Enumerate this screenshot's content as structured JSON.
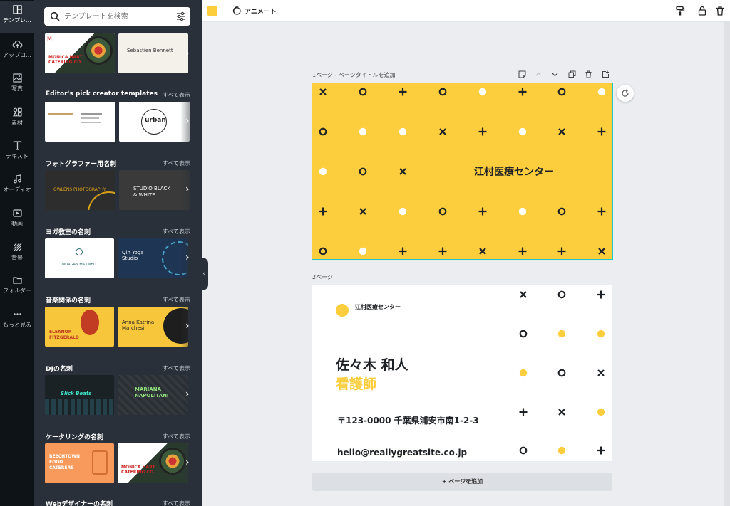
{
  "rail": {
    "items": [
      {
        "label": "テンプレ…",
        "icon": "template-icon"
      },
      {
        "label": "アップロ…",
        "icon": "upload-icon"
      },
      {
        "label": "写真",
        "icon": "photo-icon"
      },
      {
        "label": "素材",
        "icon": "elements-icon"
      },
      {
        "label": "テキスト",
        "icon": "text-icon"
      },
      {
        "label": "オーディオ",
        "icon": "audio-icon"
      },
      {
        "label": "動画",
        "icon": "video-icon"
      },
      {
        "label": "背景",
        "icon": "background-icon"
      },
      {
        "label": "フォルダー",
        "icon": "folder-icon"
      },
      {
        "label": "もっと見る",
        "icon": "more-icon"
      }
    ]
  },
  "search": {
    "placeholder": "テンプレートを検索"
  },
  "panel": {
    "see_all": "すべて表示",
    "sections": [
      {
        "title": "Editor's pick creator templates"
      },
      {
        "title": "フォトグラファー用名刺"
      },
      {
        "title": "ヨガ教室の名刺"
      },
      {
        "title": "音楽関係の名刺"
      },
      {
        "title": "DJの名刺"
      },
      {
        "title": "ケータリングの名刺"
      },
      {
        "title": "Webデザイナーの名刺"
      }
    ],
    "thumb_text": {
      "monica": "MONICA HART\nCATERING CO.",
      "sebastien": "Sebastien Bennett",
      "urban": "urban",
      "owlens": "OWLENS PHOTOGRAPHY",
      "studio": "STUDIO BLACK\n& WHITE",
      "morgan": "MORGAN MAXWELL",
      "qin": "Qin Yoga\nStudio",
      "eleanor": "ELEANOR\nFITZGERALD",
      "anna": "Anna Katrina\nMarchesi",
      "slick": "Slick Beats",
      "mariana": "MARIANA\nNAPOLITANI",
      "beechtown": "BEECHTOWN\nFOOD\nCATERERS",
      "monica2": "MONICA HART\nCATERING CO."
    }
  },
  "topbar": {
    "animate_label": "アニメート",
    "swatch_color": "#fccd3d"
  },
  "canvas": {
    "page1_label": "1ページ - ページタイトルを追加",
    "page2_label": "2ページ",
    "add_page_label": "+ ページを追加",
    "accent": "#fccd3d",
    "selection_color": "#1fc7c7"
  },
  "page1": {
    "title": "江村医療センター",
    "pattern": [
      [
        "x",
        "o",
        "+",
        "o",
        "dot",
        "+",
        "o",
        "dot"
      ],
      [
        "o",
        "dot",
        "dot",
        "x",
        "+",
        "dot",
        "x",
        "+"
      ],
      [
        "dot",
        "o",
        "x",
        "",
        "",
        "",
        "",
        ""
      ],
      [
        "+",
        "x",
        "dot",
        "o",
        "+",
        "dot",
        "o",
        "+"
      ],
      [
        "o",
        "dot",
        "+",
        "+",
        "x",
        "+",
        "+",
        "x"
      ]
    ]
  },
  "page2": {
    "org": "江村医療センター",
    "name": "佐々木 和人",
    "role": "看護師",
    "address": "〒123-0000 千葉県浦安市南1-2-3",
    "email": "hello@reallygreatsite.co.jp",
    "pattern": [
      [
        "x",
        "o",
        "+"
      ],
      [
        "o",
        "ydot",
        "ydot"
      ],
      [
        "ydot",
        "o",
        "x"
      ],
      [
        "+",
        "x",
        "ydot"
      ],
      [
        "o",
        "ydot",
        "+"
      ]
    ]
  }
}
